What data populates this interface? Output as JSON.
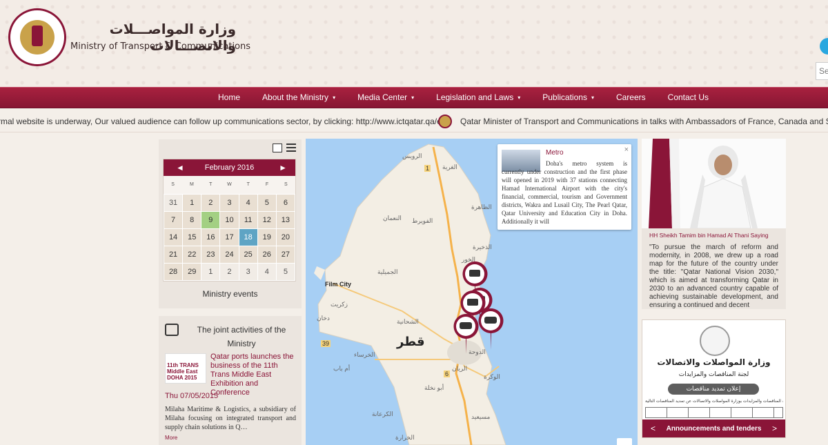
{
  "header": {
    "logo_ar": "وزارة المواصـــلات والاتصـــالات",
    "logo_en": "Ministry of Transport & Communications",
    "search_placeholder": "Se"
  },
  "nav": {
    "items": [
      {
        "label": "Home",
        "has_caret": false
      },
      {
        "label": "About the Ministry",
        "has_caret": true
      },
      {
        "label": "Media Center",
        "has_caret": true
      },
      {
        "label": "Legislation and Laws",
        "has_caret": true
      },
      {
        "label": "Publications",
        "has_caret": true
      },
      {
        "label": "Careers",
        "has_caret": false
      },
      {
        "label": "Contact Us",
        "has_caret": false
      }
    ],
    "caret_glyph": "▾"
  },
  "ticker": {
    "item1": "rmal website is underway, Our valued audience can follow up communications sector, by clicking: http://www.ictqatar.qa/en",
    "item2": "Qatar Minister of Transport and Communications in talks with Ambassadors of France, Canada and Swaz"
  },
  "calendar": {
    "month_label": "February 2016",
    "prev": "◄",
    "next": "►",
    "weekdays": [
      "S",
      "M",
      "T",
      "W",
      "T",
      "F",
      "S"
    ],
    "weeks": [
      [
        "31",
        "1",
        "2",
        "3",
        "4",
        "5",
        "6"
      ],
      [
        "7",
        "8",
        "9",
        "10",
        "11",
        "12",
        "13"
      ],
      [
        "14",
        "15",
        "16",
        "17",
        "18",
        "19",
        "20"
      ],
      [
        "21",
        "22",
        "23",
        "24",
        "25",
        "26",
        "27"
      ],
      [
        "28",
        "29",
        "1",
        "2",
        "3",
        "4",
        "5"
      ]
    ],
    "muted_cells": [
      0,
      30,
      31,
      32,
      33,
      34
    ],
    "event_cells": [
      9
    ],
    "today_cells": [
      18
    ],
    "caption": "Ministry events"
  },
  "activities": {
    "title": "The joint activities of the Ministry",
    "thumb_text": "11th TRANS Middle East DOHA 2015",
    "link": "Qatar ports launches the business of the 11th Trans Middle East Exhibition and Conference",
    "date": "Thu 07/05/2015",
    "body": "Milaha Maritime & Logistics, a subsidiary of Milaha focusing on integrated transport and supply chain solutions in Q…",
    "more": "More"
  },
  "map": {
    "popup_title": "Metro",
    "popup_close": "×",
    "popup_text": "Doha's metro system is currently under construction and the first phase will opened in 2019 with 37 stations connecting Hamad International Airport with the city's financial, commercial, tourism and Government districts, Wakra and Lusail City, The Pearl Qatar, Qatar University and Education City in Doha. Additionally it will",
    "labels": {
      "ruwais": "الرويس",
      "ghariya": "الغرية",
      "dhahira": "الظاهرة",
      "naaman": "النعمان",
      "fuwairit": "الفويرط",
      "khor": "الخور",
      "dhakhira": "الذخيرة",
      "jumayliyah": "الجميلية",
      "film_city": "Film City",
      "zekreet": "زكريت",
      "dukhan": "دخان",
      "shahaniyah": "الشحانية",
      "qatar": "قطر",
      "kharsaa": "الخرساء",
      "doha": "الدوحة",
      "rayyan": "الريان",
      "umm_bab": "أم باب",
      "wakra": "الوكرة",
      "abu_nakhla": "أبو نخلة",
      "karana": "الكرعانة",
      "mesaieed": "مسيعيد",
      "kharara": "الخرارة",
      "road1": "1",
      "road39": "39",
      "road6": "6"
    }
  },
  "saying": {
    "title": "HH Sheikh Tamim bin Hamad Al Thani Saying",
    "text": "\"To pursue the march of reform and modernity, in 2008, we drew up a road map for the future of the country under the title: \"Qatar National Vision 2030,\" which is aimed at transforming Qatar in 2030 to an advanced country capable of achieving sustainable development, and ensuring a continued and decent"
  },
  "tender": {
    "ar_title": "وزارة المواصلات والاتصالات",
    "ar_sub": "لجنة المناقصات والمزايدات",
    "ar_banner": "إعلان تمديد مناقصات",
    "ar_line": "تعلن لجنة المناقصات والمزايدات بوزارة المواصلات والاتصالات عن تمديد المناقصات التالية ..",
    "bar_label": "Announcements and tenders",
    "prev": "<",
    "next": ">"
  },
  "colors": {
    "brand": "#8a1538",
    "event": "#a3d083",
    "today": "#5ea4c4",
    "water": "#a7cff4"
  }
}
